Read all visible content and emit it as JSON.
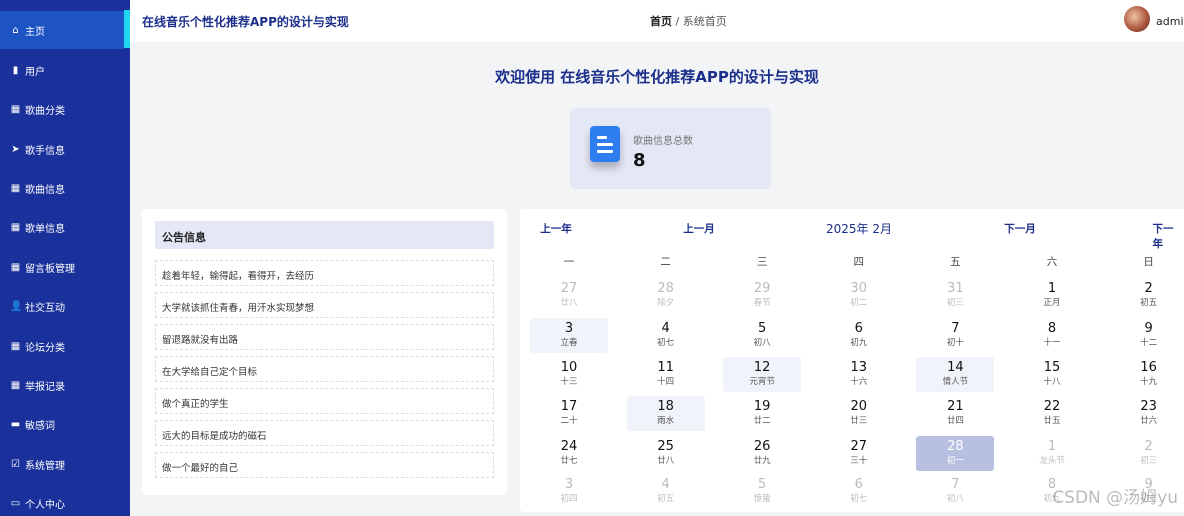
{
  "app": {
    "title": "在线音乐个性化推荐APP的设计与实现",
    "user": "admin"
  },
  "breadcrumb": {
    "home": "首页",
    "separator": "/",
    "current": "系统首页"
  },
  "sidebar": {
    "items": [
      {
        "label": "主页",
        "icon": "home-icon",
        "glyph": "⌂"
      },
      {
        "label": "用户",
        "icon": "book-icon",
        "glyph": "▮"
      },
      {
        "label": "歌曲分类",
        "icon": "grid-icon",
        "glyph": "▦"
      },
      {
        "label": "歌手信息",
        "icon": "send-icon",
        "glyph": "➤"
      },
      {
        "label": "歌曲信息",
        "icon": "grid-icon",
        "glyph": "▦"
      },
      {
        "label": "歌单信息",
        "icon": "grid-icon",
        "glyph": "▦"
      },
      {
        "label": "留言板管理",
        "icon": "grid-icon",
        "glyph": "▦"
      },
      {
        "label": "社交互动",
        "icon": "user-icon",
        "glyph": "👤"
      },
      {
        "label": "论坛分类",
        "icon": "grid-icon",
        "glyph": "▦"
      },
      {
        "label": "举报记录",
        "icon": "grid-icon",
        "glyph": "▦"
      },
      {
        "label": "敏感词",
        "icon": "ticket-icon",
        "glyph": "▬"
      },
      {
        "label": "系统管理",
        "icon": "clipboard-icon",
        "glyph": "☑"
      },
      {
        "label": "个人中心",
        "icon": "wallet-icon",
        "glyph": "▭"
      }
    ]
  },
  "welcome": "欢迎使用 在线音乐个性化推荐APP的设计与实现",
  "stat": {
    "label": "歌曲信息总数",
    "value": "8"
  },
  "notice": {
    "title": "公告信息",
    "items": [
      "趁着年轻，输得起，看得开，去经历",
      "大学就该抓住青春，用汗水实现梦想",
      "留退路就没有出路",
      "在大学给自己定个目标",
      "做个真正的学生",
      "远大的目标是成功的磁石",
      "做一个最好的自己"
    ]
  },
  "calendar": {
    "prev_year": "上一年",
    "prev_month": "上一月",
    "month": "2025年 2月",
    "next_month": "下一月",
    "next_year": "下一年",
    "weekdays": [
      "一",
      "二",
      "三",
      "四",
      "五",
      "六",
      "日"
    ],
    "cells": [
      [
        "27",
        "廿八",
        1,
        0
      ],
      [
        "28",
        "除夕",
        1,
        0
      ],
      [
        "29",
        "春节",
        1,
        0
      ],
      [
        "30",
        "初二",
        1,
        0
      ],
      [
        "31",
        "初三",
        1,
        0
      ],
      [
        "1",
        "正月",
        0,
        0
      ],
      [
        "2",
        "初五",
        0,
        0
      ],
      [
        "3",
        "立春",
        0,
        1
      ],
      [
        "4",
        "初七",
        0,
        0
      ],
      [
        "5",
        "初八",
        0,
        0
      ],
      [
        "6",
        "初九",
        0,
        0
      ],
      [
        "7",
        "初十",
        0,
        0
      ],
      [
        "8",
        "十一",
        0,
        0
      ],
      [
        "9",
        "十二",
        0,
        0
      ],
      [
        "10",
        "十三",
        0,
        0
      ],
      [
        "11",
        "十四",
        0,
        0
      ],
      [
        "12",
        "元宵节",
        0,
        1
      ],
      [
        "13",
        "十六",
        0,
        0
      ],
      [
        "14",
        "情人节",
        0,
        1
      ],
      [
        "15",
        "十八",
        0,
        0
      ],
      [
        "16",
        "十九",
        0,
        0
      ],
      [
        "17",
        "二十",
        0,
        0
      ],
      [
        "18",
        "雨水",
        0,
        1
      ],
      [
        "19",
        "廿二",
        0,
        0
      ],
      [
        "20",
        "廿三",
        0,
        0
      ],
      [
        "21",
        "廿四",
        0,
        0
      ],
      [
        "22",
        "廿五",
        0,
        0
      ],
      [
        "23",
        "廿六",
        0,
        0
      ],
      [
        "24",
        "廿七",
        0,
        0
      ],
      [
        "25",
        "廿八",
        0,
        0
      ],
      [
        "26",
        "廿九",
        0,
        0
      ],
      [
        "27",
        "三十",
        0,
        0
      ],
      [
        "28",
        "初一",
        0,
        2
      ],
      [
        "1",
        "龙头节",
        1,
        0
      ],
      [
        "2",
        "初三",
        1,
        0
      ],
      [
        "3",
        "初四",
        1,
        0
      ],
      [
        "4",
        "初五",
        1,
        0
      ],
      [
        "5",
        "惊蛰",
        1,
        0
      ],
      [
        "6",
        "初七",
        1,
        0
      ],
      [
        "7",
        "初八",
        1,
        0
      ],
      [
        "8",
        "初九",
        1,
        0
      ],
      [
        "9",
        "初十",
        1,
        0
      ]
    ]
  },
  "watermark": "CSDN @汤姆yu"
}
